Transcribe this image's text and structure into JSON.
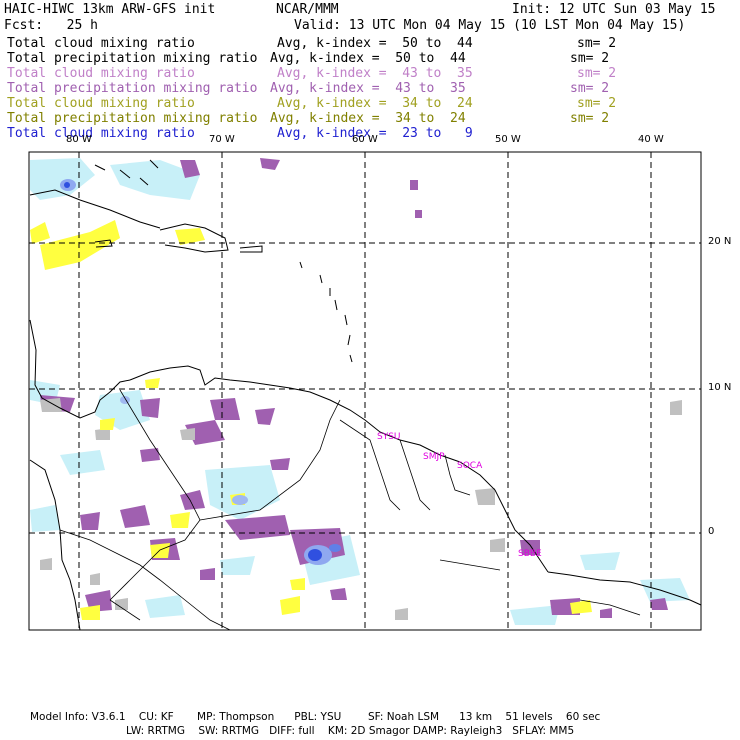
{
  "header": {
    "title": "HAIC-HIWC 13km ARW-GFS init",
    "org": "NCAR/MMM",
    "init": "Init: 12 UTC Sun 03 May 15",
    "fcst": "Fcst:   25 h",
    "valid": "Valid: 13 UTC Mon 04 May 15 (10 LST Mon 04 May 15)"
  },
  "legend": [
    {
      "field": "Total cloud mixing ratio",
      "avg": "Avg, k-index =  50 to  44",
      "sm": "sm= 2",
      "color": "#000000"
    },
    {
      "field": "Total precipitation mixing ratio",
      "avg": "Avg, k-index =  50 to  44",
      "sm": "sm= 2",
      "color": "#000000"
    },
    {
      "field": "Total cloud mixing ratio",
      "avg": "Avg, k-index =  43 to  35",
      "sm": "sm= 2",
      "color": "#c080c8"
    },
    {
      "field": "Total precipitation mixing ratio",
      "avg": "Avg, k-index =  43 to  35",
      "sm": "sm= 2",
      "color": "#a060b0"
    },
    {
      "field": "Total cloud mixing ratio",
      "avg": "Avg, k-index =  34 to  24",
      "sm": "sm= 2",
      "color": "#a0a020"
    },
    {
      "field": "Total precipitation mixing ratio",
      "avg": "Avg, k-index =  34 to  24",
      "sm": "sm= 2",
      "color": "#808000"
    },
    {
      "field": "Total cloud mixing ratio",
      "avg": "Avg, k-index =  23 to   9",
      "sm": "",
      "color": "#2020d0"
    }
  ],
  "map": {
    "lon_labels": [
      "80 W",
      "70 W",
      "60 W",
      "50 W",
      "40 W"
    ],
    "lat_labels": [
      "20 N",
      "10 N",
      "0"
    ],
    "stations": [
      "SYSU",
      "SMJP",
      "SOCA",
      "SBBE"
    ],
    "colors": {
      "cloud_high": "#c8f0f8",
      "precip_high": "#c0c0c0",
      "cloud_mid": "#a060b0",
      "precip_mid": "#a060b0",
      "cloud_low": "#ffff40",
      "cloud_deep": "#3050e0",
      "station": "#e000e0"
    }
  },
  "footer": {
    "line1": "Model Info: V3.6.1    CU: KF       MP: Thompson      PBL: YSU        SF: Noah LSM      13 km    51 levels    60 sec",
    "line2": "LW: RRTMG    SW: RRTMG   DIFF: full    KM: 2D Smagor DAMP: Rayleigh3   SFLAY: MM5"
  }
}
